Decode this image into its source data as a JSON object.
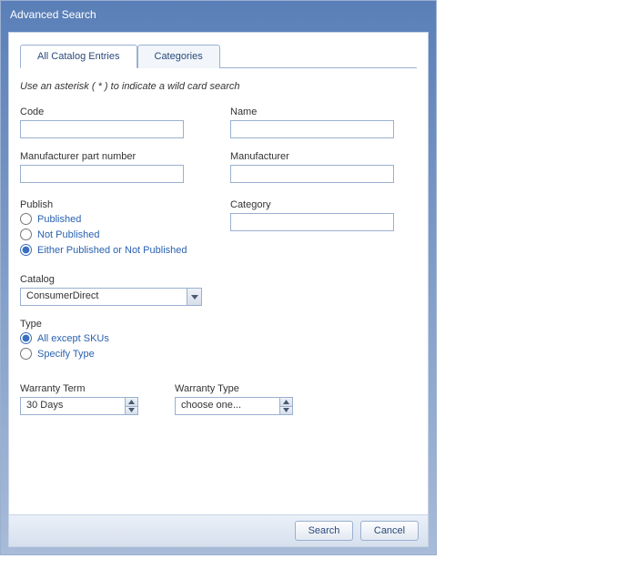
{
  "window": {
    "title": "Advanced Search"
  },
  "tabs": {
    "items": [
      {
        "label": "All Catalog Entries",
        "active": true
      },
      {
        "label": "Categories",
        "active": false
      }
    ]
  },
  "hint": "Use an asterisk ( * ) to indicate a wild card search",
  "fields": {
    "code": {
      "label": "Code",
      "value": ""
    },
    "name": {
      "label": "Name",
      "value": ""
    },
    "mfr_part": {
      "label": "Manufacturer part number",
      "value": ""
    },
    "manufacturer": {
      "label": "Manufacturer",
      "value": ""
    },
    "category": {
      "label": "Category",
      "value": ""
    }
  },
  "publish": {
    "label": "Publish",
    "options": {
      "published": "Published",
      "not_published": "Not Published",
      "either": "Either Published or Not Published"
    },
    "selected": "either"
  },
  "catalog": {
    "label": "Catalog",
    "selected": "ConsumerDirect"
  },
  "type": {
    "label": "Type",
    "options": {
      "all_except_skus": "All except SKUs",
      "specify": "Specify Type"
    },
    "selected": "all_except_skus"
  },
  "warranty_term": {
    "label": "Warranty Term",
    "value": "30 Days"
  },
  "warranty_type": {
    "label": "Warranty Type",
    "value": "choose one..."
  },
  "buttons": {
    "search": "Search",
    "cancel": "Cancel"
  }
}
